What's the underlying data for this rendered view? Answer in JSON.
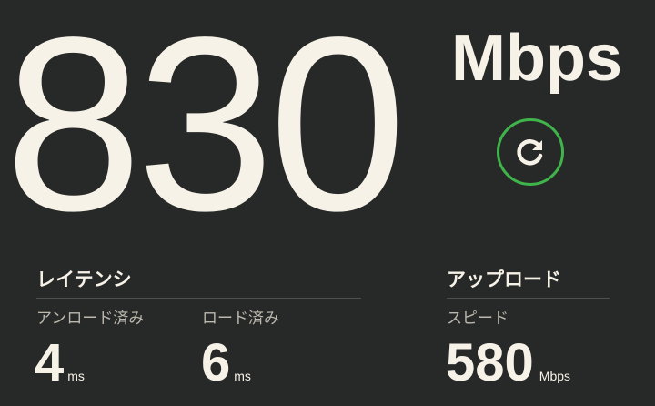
{
  "download": {
    "value": "830",
    "unit": "Mbps"
  },
  "refresh": {
    "icon": "refresh-icon",
    "ring_color": "#3fb44a"
  },
  "latency": {
    "title": "レイテンシ",
    "unloaded": {
      "label": "アンロード済み",
      "value": "4",
      "unit": "ms"
    },
    "loaded": {
      "label": "ロード済み",
      "value": "6",
      "unit": "ms"
    }
  },
  "upload": {
    "title": "アップロード",
    "speed": {
      "label": "スピード",
      "value": "580",
      "unit": "Mbps"
    }
  },
  "colors": {
    "background": "#272928",
    "text": "#f7f2e8",
    "secondary_text": "#bdb8ae",
    "accent": "#3fb44a"
  }
}
